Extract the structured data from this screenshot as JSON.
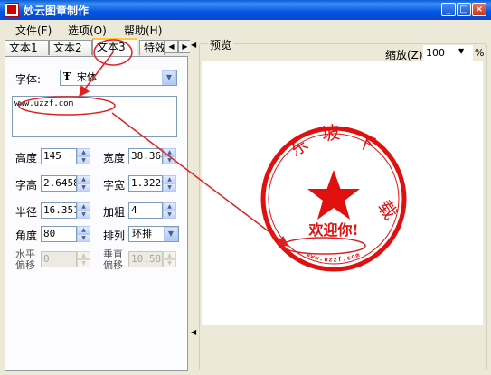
{
  "window": {
    "title": "妙云图章制作"
  },
  "menu": [
    {
      "label": "文件(F)"
    },
    {
      "label": "选项(O)"
    },
    {
      "label": "帮助(H)"
    }
  ],
  "tabs": [
    {
      "label": "文本1"
    },
    {
      "label": "文本2"
    },
    {
      "label": "文本3"
    },
    {
      "label": "特效"
    }
  ],
  "form": {
    "font_label": "字体:",
    "font_value": "宋体",
    "font_icon": "truetype-font-icon",
    "text_value": "www.uzzf.com",
    "height_label": "高度",
    "height_value": "145",
    "width_label": "宽度",
    "width_value": "38.364",
    "char_height_label": "字高",
    "char_height_value": "2.6458",
    "char_width_label": "字宽",
    "char_width_value": "1.3229",
    "radius_label": "半径",
    "radius_value": "16.351",
    "bold_label": "加粗",
    "bold_value": "4",
    "angle_label": "角度",
    "angle_value": "80",
    "layout_label": "排列",
    "layout_value": "环排",
    "hoffset_label": "水平偏移",
    "hoffset_value": "0",
    "voffset_label": "垂直偏移",
    "voffset_value": "10.583"
  },
  "preview": {
    "legend": "预览",
    "zoom_label": "缩放(Z)",
    "zoom_value": "100",
    "zoom_unit": "%",
    "seal_color": "#e01010",
    "top_chars": [
      "东",
      "坡",
      "下",
      "载"
    ],
    "center_text": "欢迎你!",
    "bottom_text": "www.uzzf.com",
    "star_icon": "star-icon"
  },
  "colors": {
    "titlebar": "#0054e3",
    "annotation": "#e02020"
  }
}
